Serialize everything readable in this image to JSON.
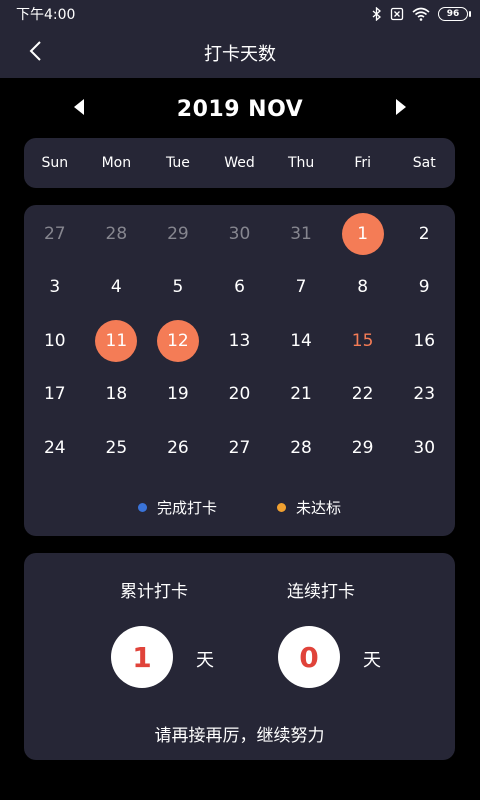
{
  "status_bar": {
    "time": "下午4:00",
    "battery_level": "96",
    "icons": [
      "bluetooth-icon",
      "no-sim-icon",
      "wifi-icon",
      "battery-icon"
    ]
  },
  "header": {
    "title": "打卡天数",
    "back_icon": "chevron-left-icon"
  },
  "calendar": {
    "month_title": "2019 NOV",
    "prev_icon": "triangle-left-icon",
    "next_icon": "triangle-right-icon",
    "weekdays": [
      "Sun",
      "Mon",
      "Tue",
      "Wed",
      "Thu",
      "Fri",
      "Sat"
    ],
    "days": [
      {
        "label": "27",
        "state": "muted"
      },
      {
        "label": "28",
        "state": "muted"
      },
      {
        "label": "29",
        "state": "muted"
      },
      {
        "label": "30",
        "state": "muted"
      },
      {
        "label": "31",
        "state": "muted"
      },
      {
        "label": "1",
        "state": "marked"
      },
      {
        "label": "2",
        "state": "normal"
      },
      {
        "label": "3",
        "state": "normal"
      },
      {
        "label": "4",
        "state": "normal"
      },
      {
        "label": "5",
        "state": "normal"
      },
      {
        "label": "6",
        "state": "normal"
      },
      {
        "label": "7",
        "state": "normal"
      },
      {
        "label": "8",
        "state": "normal"
      },
      {
        "label": "9",
        "state": "normal"
      },
      {
        "label": "10",
        "state": "normal"
      },
      {
        "label": "11",
        "state": "marked"
      },
      {
        "label": "12",
        "state": "marked"
      },
      {
        "label": "13",
        "state": "normal"
      },
      {
        "label": "14",
        "state": "normal"
      },
      {
        "label": "15",
        "state": "today"
      },
      {
        "label": "16",
        "state": "normal"
      },
      {
        "label": "17",
        "state": "normal"
      },
      {
        "label": "18",
        "state": "normal"
      },
      {
        "label": "19",
        "state": "normal"
      },
      {
        "label": "20",
        "state": "normal"
      },
      {
        "label": "21",
        "state": "normal"
      },
      {
        "label": "22",
        "state": "normal"
      },
      {
        "label": "23",
        "state": "normal"
      },
      {
        "label": "24",
        "state": "normal"
      },
      {
        "label": "25",
        "state": "normal"
      },
      {
        "label": "26",
        "state": "normal"
      },
      {
        "label": "27",
        "state": "normal"
      },
      {
        "label": "28",
        "state": "normal"
      },
      {
        "label": "29",
        "state": "normal"
      },
      {
        "label": "30",
        "state": "normal"
      }
    ],
    "legend": [
      {
        "label": "完成打卡",
        "color": "#3a73d8"
      },
      {
        "label": "未达标",
        "color": "#f0a030"
      }
    ]
  },
  "stats": {
    "total_label": "累计打卡",
    "total_value": "1",
    "streak_label": "连续打卡",
    "streak_value": "0",
    "unit": "天",
    "message": "请再接再厉，继续努力"
  },
  "colors": {
    "background": "#000000",
    "card": "#262636",
    "accent": "#f47c56",
    "stat_number": "#e0433a"
  }
}
